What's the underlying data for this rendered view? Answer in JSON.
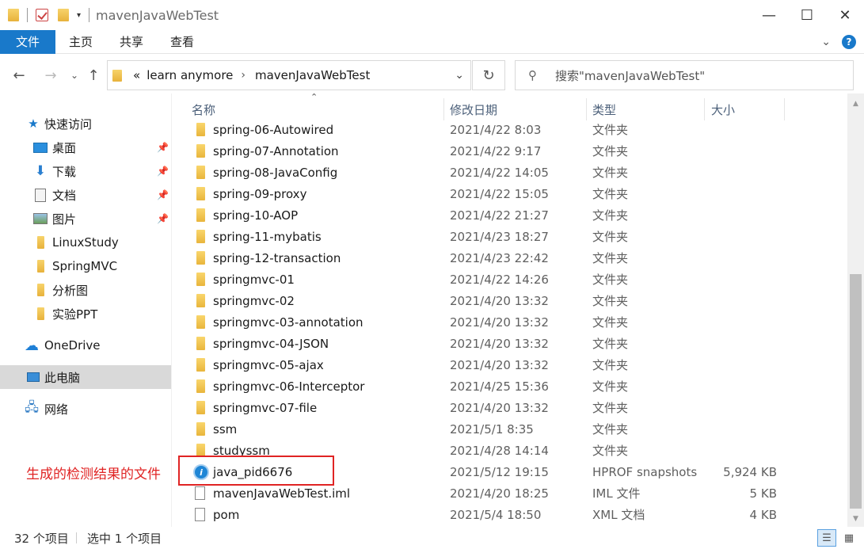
{
  "window": {
    "title": "mavenJavaWebTest",
    "minimize": "—",
    "maximize": "☐",
    "close": "✕"
  },
  "ribbon": {
    "tabs": [
      "文件",
      "主页",
      "共享",
      "查看"
    ]
  },
  "address": {
    "breadcrumbs": [
      "learn anymore",
      "mavenJavaWebTest"
    ],
    "overflow": "«",
    "search_placeholder": "搜索\"mavenJavaWebTest\""
  },
  "sidebar": {
    "quick_access": "快速访问",
    "items": [
      {
        "label": "桌面",
        "icon": "desktop-icon",
        "pinned": true
      },
      {
        "label": "下载",
        "icon": "download-icon",
        "pinned": true
      },
      {
        "label": "文档",
        "icon": "documents-icon",
        "pinned": true
      },
      {
        "label": "图片",
        "icon": "pictures-icon",
        "pinned": true
      },
      {
        "label": "LinuxStudy",
        "icon": "folder-icon",
        "pinned": false
      },
      {
        "label": "SpringMVC",
        "icon": "folder-icon",
        "pinned": false
      },
      {
        "label": "分析图",
        "icon": "folder-icon",
        "pinned": false
      },
      {
        "label": "实验PPT",
        "icon": "folder-icon",
        "pinned": false
      }
    ],
    "onedrive": "OneDrive",
    "this_pc": "此电脑",
    "network": "网络"
  },
  "columns": {
    "name": "名称",
    "modified": "修改日期",
    "type": "类型",
    "size": "大小"
  },
  "files": [
    {
      "name": "spring-06-Autowired",
      "date": "2021/4/22 8:03",
      "type": "文件夹",
      "size": "",
      "kind": "folder"
    },
    {
      "name": "spring-07-Annotation",
      "date": "2021/4/22 9:17",
      "type": "文件夹",
      "size": "",
      "kind": "folder"
    },
    {
      "name": "spring-08-JavaConfig",
      "date": "2021/4/22 14:05",
      "type": "文件夹",
      "size": "",
      "kind": "folder"
    },
    {
      "name": "spring-09-proxy",
      "date": "2021/4/22 15:05",
      "type": "文件夹",
      "size": "",
      "kind": "folder"
    },
    {
      "name": "spring-10-AOP",
      "date": "2021/4/22 21:27",
      "type": "文件夹",
      "size": "",
      "kind": "folder"
    },
    {
      "name": "spring-11-mybatis",
      "date": "2021/4/23 18:27",
      "type": "文件夹",
      "size": "",
      "kind": "folder"
    },
    {
      "name": "spring-12-transaction",
      "date": "2021/4/23 22:42",
      "type": "文件夹",
      "size": "",
      "kind": "folder"
    },
    {
      "name": "springmvc-01",
      "date": "2021/4/22 14:26",
      "type": "文件夹",
      "size": "",
      "kind": "folder"
    },
    {
      "name": "springmvc-02",
      "date": "2021/4/20 13:32",
      "type": "文件夹",
      "size": "",
      "kind": "folder"
    },
    {
      "name": "springmvc-03-annotation",
      "date": "2021/4/20 13:32",
      "type": "文件夹",
      "size": "",
      "kind": "folder"
    },
    {
      "name": "springmvc-04-JSON",
      "date": "2021/4/20 13:32",
      "type": "文件夹",
      "size": "",
      "kind": "folder"
    },
    {
      "name": "springmvc-05-ajax",
      "date": "2021/4/20 13:32",
      "type": "文件夹",
      "size": "",
      "kind": "folder"
    },
    {
      "name": "springmvc-06-Interceptor",
      "date": "2021/4/25 15:36",
      "type": "文件夹",
      "size": "",
      "kind": "folder"
    },
    {
      "name": "springmvc-07-file",
      "date": "2021/4/20 13:32",
      "type": "文件夹",
      "size": "",
      "kind": "folder"
    },
    {
      "name": "ssm",
      "date": "2021/5/1 8:35",
      "type": "文件夹",
      "size": "",
      "kind": "folder"
    },
    {
      "name": "studyssm",
      "date": "2021/4/28 14:14",
      "type": "文件夹",
      "size": "",
      "kind": "folder"
    },
    {
      "name": "java_pid6676",
      "date": "2021/5/12 19:15",
      "type": "HPROF snapshots",
      "size": "5,924 KB",
      "kind": "hprof"
    },
    {
      "name": "mavenJavaWebTest.iml",
      "date": "2021/4/20 18:25",
      "type": "IML 文件",
      "size": "5 KB",
      "kind": "file"
    },
    {
      "name": "pom",
      "date": "2021/5/4 18:50",
      "type": "XML 文档",
      "size": "4 KB",
      "kind": "file"
    }
  ],
  "annotation": "生成的检测结果的文件",
  "status": {
    "count": "32 个项目",
    "selected": "选中 1 个项目"
  },
  "colors": {
    "accent": "#1979ca",
    "annotation": "#e02424",
    "folder": "#e9b53c"
  }
}
